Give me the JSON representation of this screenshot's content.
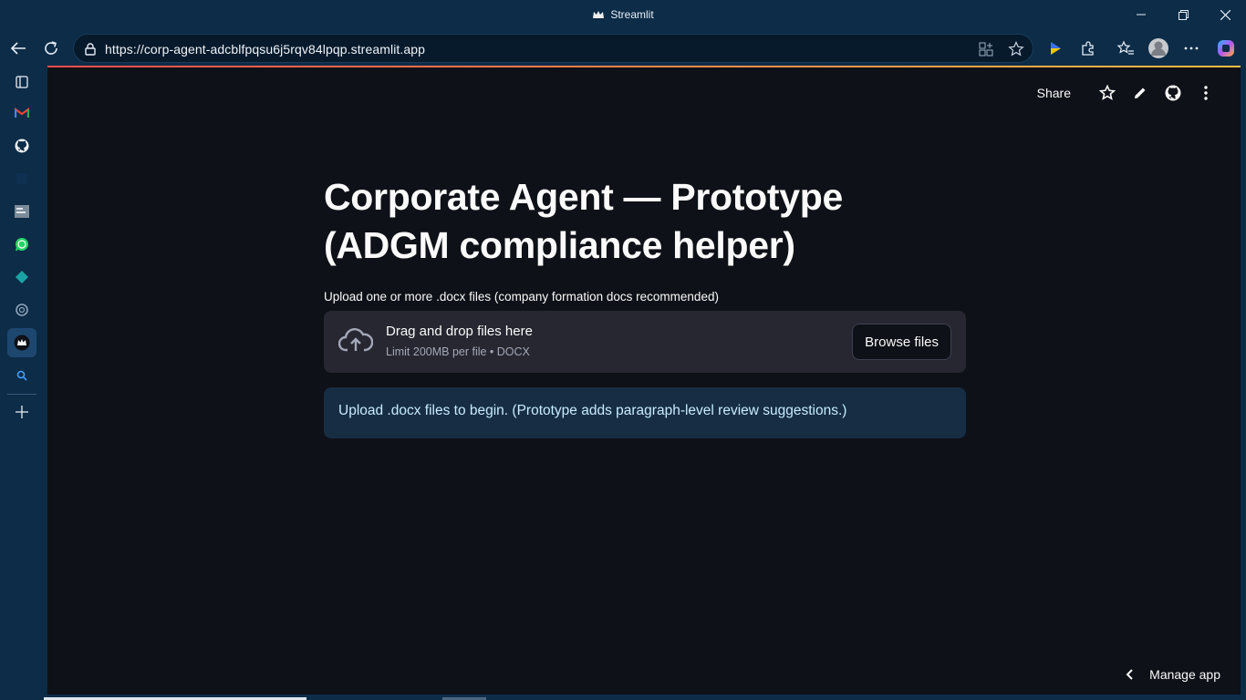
{
  "window": {
    "title": "Streamlit"
  },
  "browser": {
    "url": "https://corp-agent-adcblfpqsu6j5rqv84lpqp.streamlit.app"
  },
  "sidebar_icons": [
    "tab-actions-icon",
    "gmail-icon",
    "github-icon",
    "blank-icon",
    "glassdoor-icon",
    "whatsapp-icon",
    "diamond-icon",
    "chatgpt-icon",
    "streamlit-icon",
    "search-icon",
    "add-icon"
  ],
  "app": {
    "toolbar": {
      "share_label": "Share"
    },
    "title": "Corporate Agent — Prototype (ADGM compliance helper)",
    "uploader": {
      "label": "Upload one or more .docx files (company formation docs recommended)",
      "drop_title": "Drag and drop files here",
      "drop_subtitle": "Limit 200MB per file • DOCX",
      "browse_label": "Browse files"
    },
    "info_message": "Upload .docx files to begin. (Prototype adds paragraph-level review suggestions.)",
    "manage_label": "Manage app"
  },
  "colors": {
    "page_bg": "#0e1117",
    "browser_chrome": "#0c2c48",
    "accent_red": "#ff4b4b",
    "info_bg": "#172d43",
    "info_text": "#c7ebff"
  }
}
